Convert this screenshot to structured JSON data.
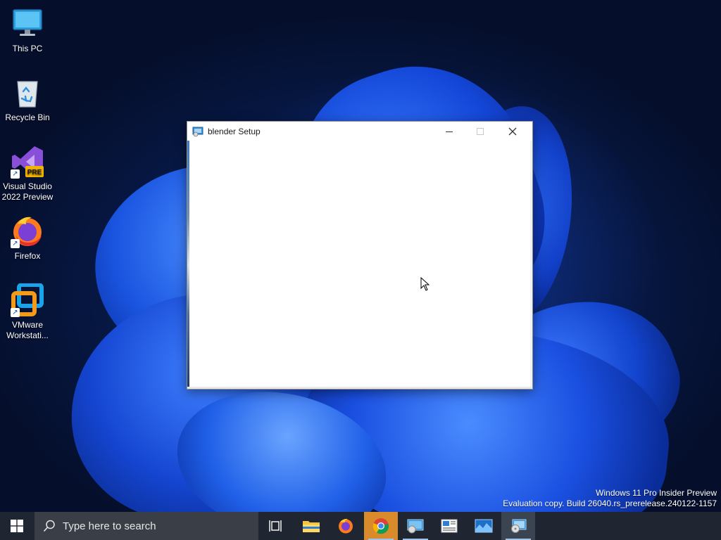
{
  "desktop": {
    "icons": [
      {
        "label": "This PC",
        "icon": "monitor-icon"
      },
      {
        "label": "Recycle Bin",
        "icon": "recycle-bin-icon"
      },
      {
        "label": "Visual Studio 2022 Preview",
        "icon": "visual-studio-icon",
        "badge": "PRE"
      },
      {
        "label": "Firefox",
        "icon": "firefox-icon"
      },
      {
        "label": "VMware Workstati...",
        "icon": "vmware-icon"
      }
    ]
  },
  "window": {
    "title": "blender Setup",
    "icon": "installer-icon",
    "controls": {
      "minimize": "minimize-icon",
      "maximize": "maximize-icon",
      "close": "close-icon"
    }
  },
  "watermark": {
    "line1": "Windows 11 Pro Insider Preview",
    "line2": "Evaluation copy. Build 26040.rs_prerelease.240122-1157"
  },
  "taskbar": {
    "search_placeholder": "Type here to search",
    "items": [
      {
        "name": "task-view",
        "icon": "task-view-icon"
      },
      {
        "name": "file-explorer",
        "icon": "folder-icon"
      },
      {
        "name": "firefox",
        "icon": "firefox-icon"
      },
      {
        "name": "chrome",
        "icon": "chrome-icon",
        "highlight_color": "#d98a2b"
      },
      {
        "name": "disk-app",
        "icon": "disk-app-icon"
      },
      {
        "name": "news-app",
        "icon": "news-icon"
      },
      {
        "name": "photo-app",
        "icon": "photo-icon"
      },
      {
        "name": "installer",
        "icon": "installer-icon"
      }
    ]
  },
  "colors": {
    "taskbar_bg": "#202631",
    "search_bg": "#3a3f47",
    "accent_chrome": "#d98a2b"
  }
}
